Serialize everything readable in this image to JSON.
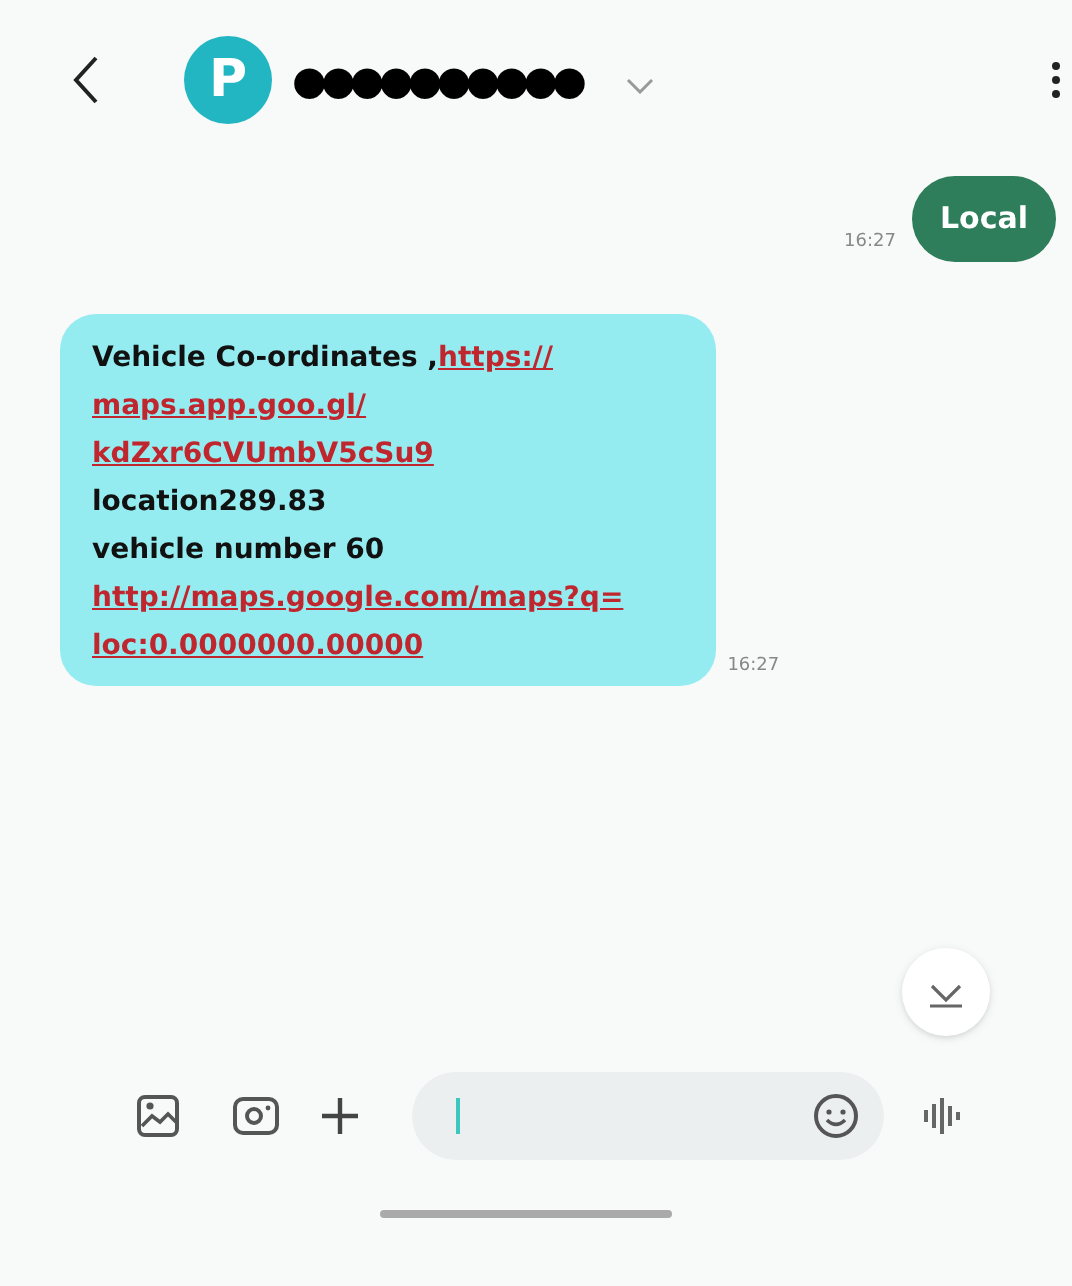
{
  "header": {
    "avatar_letter": "P",
    "contact": "●●●●●●●●●●"
  },
  "messages": [
    {
      "kind": "sent",
      "time": "16:27",
      "lines": [
        [
          {
            "kind": "text",
            "text": "Local"
          }
        ]
      ]
    },
    {
      "kind": "received",
      "time": "16:27",
      "lines": [
        [
          {
            "kind": "text",
            "text": "Vehicle Co-ordinates ,"
          },
          {
            "kind": "link",
            "text": "https://"
          }
        ],
        [
          {
            "kind": "link",
            "text": "maps.app.goo.gl/"
          }
        ],
        [
          {
            "kind": "link",
            "text": "kdZxr6CVUmbV5cSu9"
          }
        ],
        [
          {
            "kind": "text",
            "text": "location289.83"
          }
        ],
        [
          {
            "kind": "text",
            "text": "vehicle number 60"
          }
        ],
        [
          {
            "kind": "link",
            "text": "http://maps.google.com/maps?q="
          }
        ],
        [
          {
            "kind": "link",
            "text": "loc:0.0000000.00000"
          }
        ]
      ]
    }
  ]
}
